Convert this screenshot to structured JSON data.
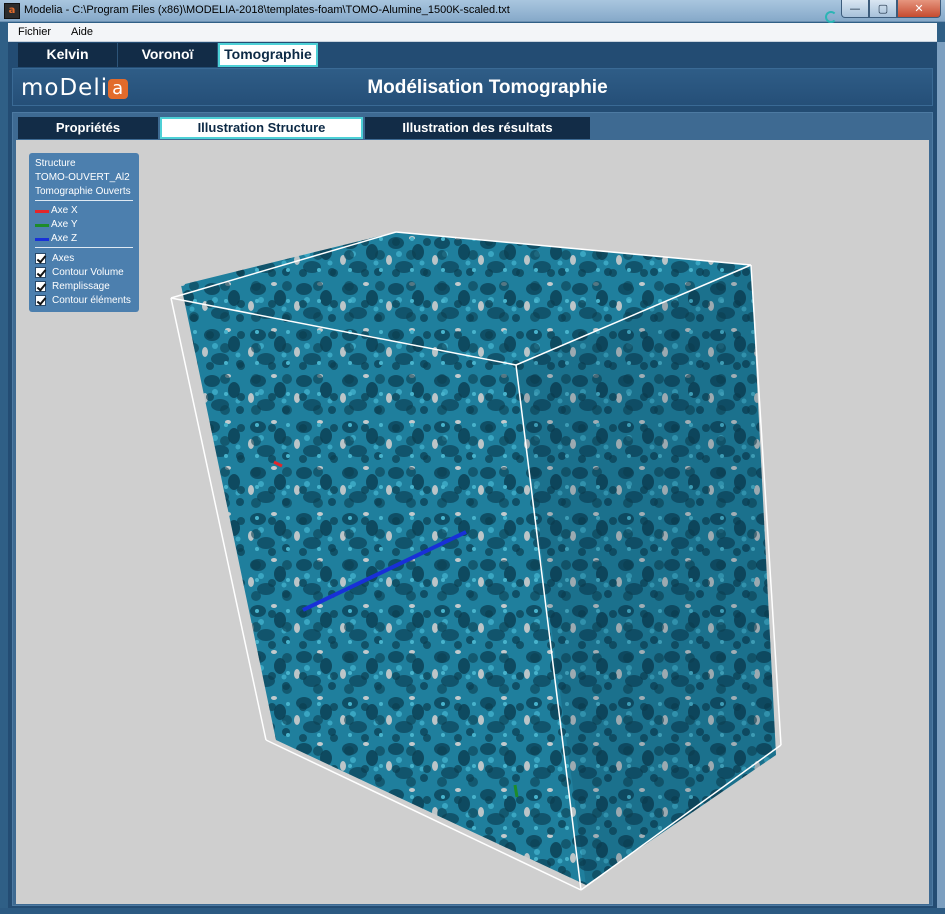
{
  "window": {
    "icon_label": "a",
    "title": "Modelia - C:\\Program Files (x86)\\MODELIA-2018\\templates-foam\\TOMO-Alumine_1500K-scaled.txt",
    "buttons": {
      "minimize": "—",
      "maximize": "▢",
      "close": "✕"
    }
  },
  "menubar": {
    "items": [
      "Fichier",
      "Aide"
    ]
  },
  "module_tabs": [
    {
      "label": "Kelvin",
      "active": false
    },
    {
      "label": "Voronoï",
      "active": false
    },
    {
      "label": "Tomographie",
      "active": true
    }
  ],
  "header": {
    "logo_text": "moDeli",
    "logo_mark": "a",
    "title": "Modélisation Tomographie"
  },
  "view_tabs": [
    {
      "label": "Propriétés",
      "active": false
    },
    {
      "label": "Illustration Structure",
      "active": true
    },
    {
      "label": "Illustration des résultats",
      "active": false
    }
  ],
  "legend": {
    "lines": [
      "Structure",
      "TOMO-OUVERT_Al2",
      "Tomographie Ouverts"
    ],
    "axes": [
      {
        "label": "Axe X",
        "color": "#e3262a"
      },
      {
        "label": "Axe Y",
        "color": "#1d8c2a"
      },
      {
        "label": "Axe Z",
        "color": "#1830d8"
      }
    ],
    "options": [
      {
        "label": "Axes",
        "checked": true
      },
      {
        "label": "Contour Volume",
        "checked": true
      },
      {
        "label": "Remplissage",
        "checked": true
      },
      {
        "label": "Contour éléments",
        "checked": true
      }
    ]
  },
  "scene": {
    "foam_color": "#1f7f9d",
    "background": "#cfcfcf",
    "box_edge_color": "#ffffff"
  }
}
